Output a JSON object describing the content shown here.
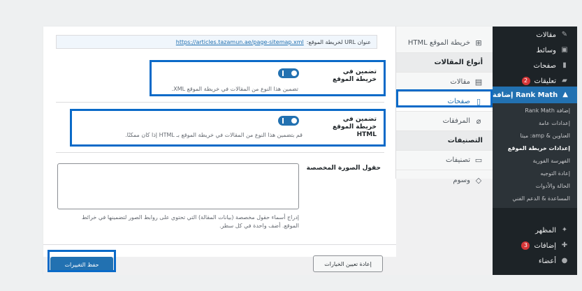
{
  "admin_menu": {
    "items": [
      {
        "label": "مقالات",
        "icon": "pin-icon"
      },
      {
        "label": "وسائط",
        "icon": "media-icon"
      },
      {
        "label": "صفحات",
        "icon": "pages-icon"
      },
      {
        "label": "تعليقات",
        "icon": "comments-icon",
        "badge": "2"
      },
      {
        "label": "Rank Math إضافة",
        "icon": "rank-math-icon",
        "active": true
      }
    ],
    "submenu": [
      "إضافة Rank Math",
      "إعدادات عامة",
      "العناوين & amp: ميتا",
      "إعدادات خريطة الموقع",
      "الفهرسة الفورية",
      "إعادة التوجيه",
      "الحالة والأدوات",
      "المساعدة & الدعم الفني"
    ],
    "submenu_current_index": 3,
    "bottom_items": [
      {
        "label": "المظهر",
        "icon": "appearance-icon"
      },
      {
        "label": "إضافات",
        "icon": "plugins-icon",
        "badge": "3"
      },
      {
        "label": "أعضاء",
        "icon": "users-icon"
      }
    ]
  },
  "settings_tabs": {
    "items": [
      {
        "label": "خريطة الموقع HTML",
        "icon": "sitemap-icon"
      },
      {
        "label": "أنواع المقالات",
        "section": true
      },
      {
        "label": "مقالات",
        "icon": "post-icon"
      },
      {
        "label": "صفحات",
        "icon": "page-icon",
        "current": true
      },
      {
        "label": "المرفقات",
        "icon": "attachment-icon"
      },
      {
        "label": "التصنيفات",
        "section": true
      },
      {
        "label": "تصنيفات",
        "icon": "folder-icon"
      },
      {
        "label": "وسوم",
        "icon": "tag-icon"
      }
    ]
  },
  "panel": {
    "sitemap_url": {
      "label": "عنوان URL لخريطة الموقع:",
      "url": "https://articles.tazamun.ae/page-sitemap.xml"
    },
    "include_sitemap": {
      "label": "تضمين في خريطة الموقع",
      "description": "تضمين هذا النوع من المقالات في خريطة الموقع XML.",
      "enabled": true
    },
    "include_html_sitemap": {
      "label": "تضمين في خريطة الموقع HTML",
      "description": "قم بتضمين هذا النوع من المقالات في خريطة الموقع بـ HTML إذا كان ممكنًا.",
      "enabled": true
    },
    "custom_image_fields": {
      "label": "حقول الصورة المخصصة",
      "value": "",
      "description": "إدراج أسماء حقول مخصصة (بيانات المقالة) التي تحتوي على روابط الصور لتضمينها في خرائط الموقع. أضف واحدة في كل سطر."
    },
    "save_button": "حفظ التغييرات",
    "reset_button": "إعادة تعيين الخيارات"
  }
}
